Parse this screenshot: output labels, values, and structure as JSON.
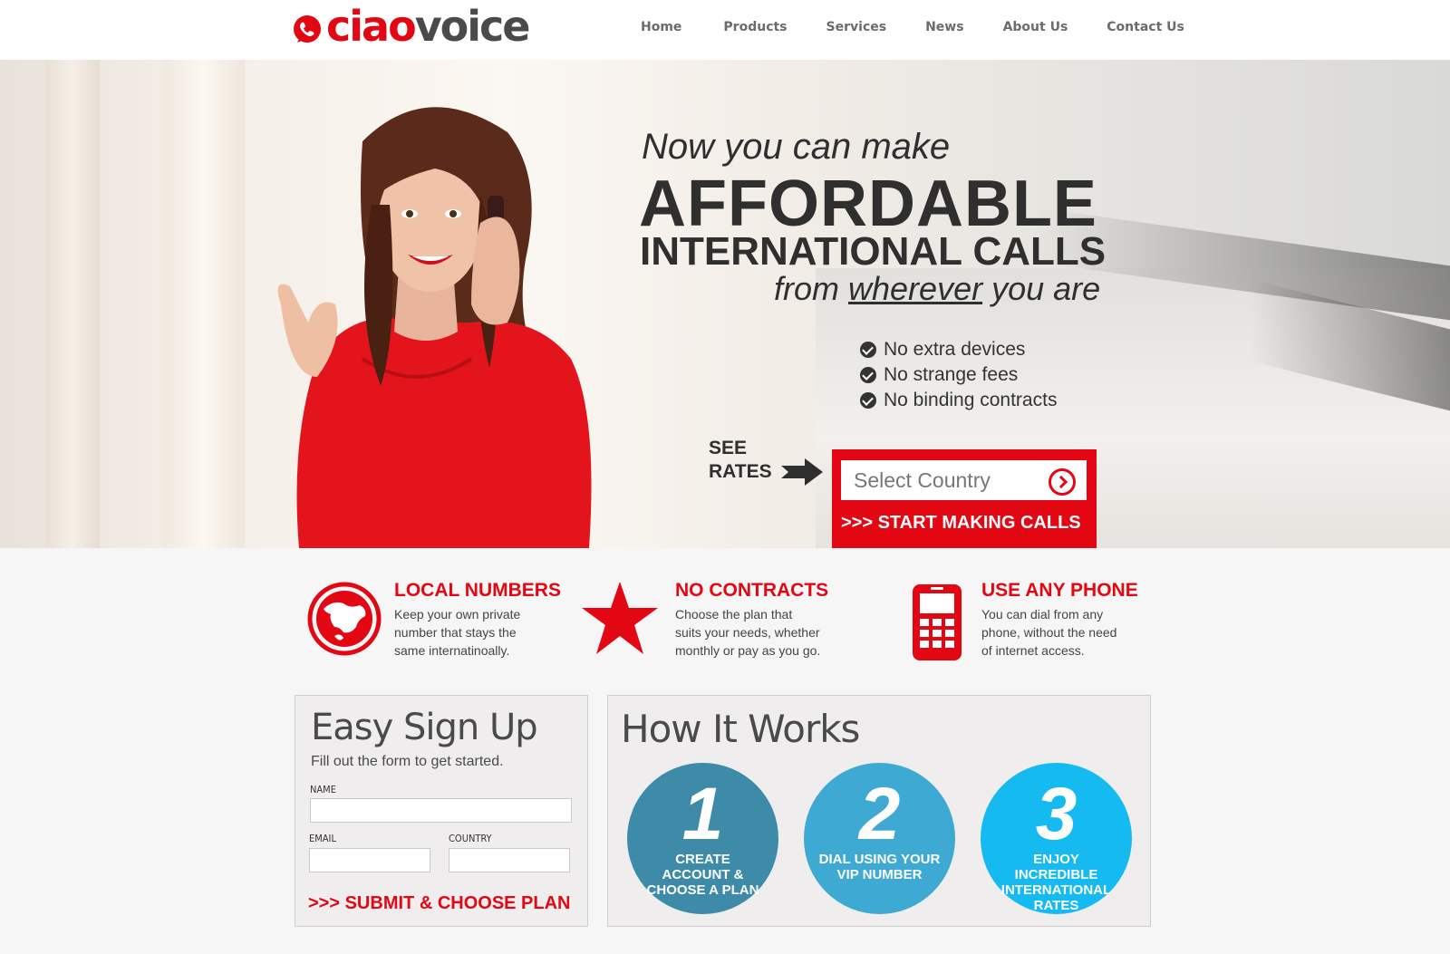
{
  "brand": {
    "ciao": "ciao",
    "voice": "voice"
  },
  "nav": {
    "items": [
      "Home",
      "Products",
      "Services",
      "News",
      "About Us",
      "Contact Us"
    ]
  },
  "hero": {
    "line1": "Now you can make",
    "line2": "AFFORDABLE",
    "line3": "INTERNATIONAL CALLS",
    "line4_pre": "from ",
    "line4_underline": "wherever",
    "line4_post": " you are",
    "checks": [
      "No extra devices",
      "No strange fees",
      "No binding contracts"
    ],
    "see_rates_1": "SEE",
    "see_rates_2": "RATES",
    "select_placeholder": "Select Country",
    "start_calls": ">>> START MAKING CALLS"
  },
  "features": [
    {
      "title": "LOCAL NUMBERS",
      "lines": [
        "Keep your own private",
        "number that stays the",
        "same internatinoally."
      ],
      "icon": "globe-icon"
    },
    {
      "title": "NO CONTRACTS",
      "lines": [
        "Choose the plan that",
        "suits your needs, whether",
        "monthly or pay as you go."
      ],
      "icon": "star-icon"
    },
    {
      "title": "USE ANY PHONE",
      "lines": [
        "You can dial from any",
        "phone, without the need",
        "of internet access."
      ],
      "icon": "phone-icon"
    }
  ],
  "signup": {
    "title": "Easy Sign Up",
    "subtitle": "Fill out the form to get started.",
    "name_label": "NAME",
    "email_label": "EMAIL",
    "country_label": "COUNTRY",
    "submit": ">>> SUBMIT & CHOOSE PLAN"
  },
  "how": {
    "title": "How It Works",
    "steps": [
      {
        "num": "1",
        "caption": "CREATE ACCOUNT & CHOOSE A PLAN",
        "color": "#3d8ba8"
      },
      {
        "num": "2",
        "caption": "DIAL USING YOUR VIP NUMBER",
        "color": "#3ea9d2"
      },
      {
        "num": "3",
        "caption": "ENJOY INCREDIBLE INTERNATIONAL RATES",
        "color": "#14baf0"
      }
    ]
  },
  "colors": {
    "accent": "#e30613",
    "dark": "#2f2f2f"
  }
}
